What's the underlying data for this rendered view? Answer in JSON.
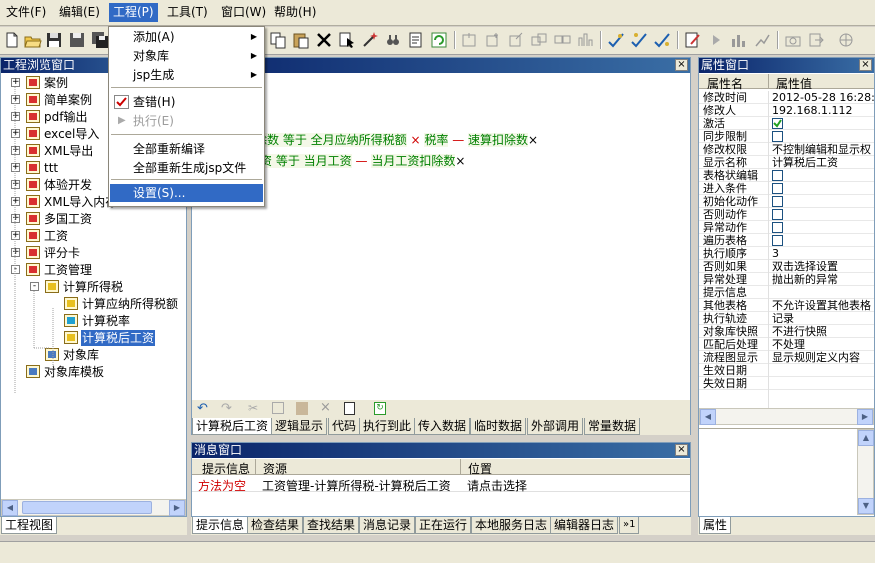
{
  "menubar": {
    "items": [
      "文件(F)",
      "编辑(E)",
      "工程(P)",
      "工具(T)",
      "窗口(W)",
      "帮助(H)"
    ]
  },
  "dropdown": {
    "items": [
      {
        "label": "添加(A)",
        "submenu": true
      },
      {
        "label": "对象库",
        "submenu": true
      },
      {
        "label": "jsp生成",
        "submenu": true
      },
      {
        "label": "查错(H)",
        "checked": true
      },
      {
        "label": "执行(E)",
        "disabled": true
      },
      {
        "label": "全部重新编译"
      },
      {
        "label": "全部重新生成jsp文件"
      },
      {
        "label": "设置(S)...",
        "highlighted": true
      }
    ]
  },
  "project_browser": {
    "title": "工程浏览窗口",
    "tree": [
      {
        "label": "案例",
        "expander": "+",
        "depth": 0
      },
      {
        "label": "简单案例",
        "expander": "+",
        "depth": 0
      },
      {
        "label": "pdf输出",
        "expander": "+",
        "depth": 0
      },
      {
        "label": "excel导入",
        "expander": "+",
        "depth": 0
      },
      {
        "label": "XML导出",
        "expander": "+",
        "depth": 0
      },
      {
        "label": "ttt",
        "expander": "+",
        "depth": 0
      },
      {
        "label": "体验开发",
        "expander": "+",
        "depth": 0
      },
      {
        "label": "XML导入内存",
        "expander": "+",
        "depth": 0
      },
      {
        "label": "多国工资",
        "expander": "+",
        "depth": 0
      },
      {
        "label": "工资",
        "expander": "+",
        "depth": 0
      },
      {
        "label": "评分卡",
        "expander": "+",
        "depth": 0
      },
      {
        "label": "工资管理",
        "expander": "-",
        "depth": 0
      },
      {
        "label": "计算所得税",
        "expander": "-",
        "depth": 1
      },
      {
        "label": "计算应纳所得税额",
        "depth": 2
      },
      {
        "label": "计算税率",
        "depth": 2
      },
      {
        "label": "计算税后工资",
        "depth": 2,
        "selected": true
      },
      {
        "label": "对象库",
        "depth": 1
      },
      {
        "label": "对象库模板",
        "depth": 0
      }
    ],
    "bottom_tab": "工程视图"
  },
  "editor": {
    "rule_lines": [
      [
        {
          "text": "除数",
          "color": "#008000"
        },
        {
          "text": " 等于 ",
          "color": "#008000"
        },
        {
          "text": "全月应纳所得税额",
          "color": "#008000"
        },
        {
          "text": " × ",
          "color": "#d00000"
        },
        {
          "text": "税率",
          "color": "#008000"
        },
        {
          "text": " — ",
          "color": "#d00000"
        },
        {
          "text": "速算扣除数",
          "color": "#008000"
        },
        {
          "text": "×",
          "color": "#000000"
        }
      ],
      [
        {
          "text": "资",
          "color": "#008000"
        },
        {
          "text": " 等于 ",
          "color": "#008000"
        },
        {
          "text": "当月工资",
          "color": "#008000"
        },
        {
          "text": " — ",
          "color": "#d00000"
        },
        {
          "text": "当月工资扣除数",
          "color": "#008000"
        },
        {
          "text": "×",
          "color": "#000000"
        }
      ]
    ],
    "tabs": [
      "计算税后工资",
      "逻辑显示",
      "代码",
      "执行到此",
      "传入数据",
      "临时数据",
      "外部调用",
      "常量数据"
    ],
    "active_tab": 0
  },
  "message_window": {
    "title": "消息窗口",
    "columns": [
      "提示信息",
      "资源",
      "位置"
    ],
    "rows": [
      {
        "hint": "方法为空",
        "resource": "工资管理-计算所得税-计算税后工资",
        "location": "请点击选择"
      }
    ],
    "tabs": [
      "提示信息",
      "检查结果",
      "查找结果",
      "消息记录",
      "正在运行",
      "本地服务日志",
      "编辑器日志"
    ],
    "more_tab": "»1"
  },
  "properties": {
    "title": "属性窗口",
    "col_name": "属性名",
    "col_value": "属性值",
    "rows": [
      {
        "name": "修改时间",
        "value": "2012-05-28 16:28:"
      },
      {
        "name": "修改人",
        "value": "192.168.1.112"
      },
      {
        "name": "激活",
        "checkbox": true,
        "checked": true
      },
      {
        "name": "同步限制",
        "checkbox": true,
        "checked": false
      },
      {
        "name": "修改权限",
        "value": "不控制编辑和显示权"
      },
      {
        "name": "显示名称",
        "value": "计算税后工资"
      },
      {
        "name": "表格状编辑",
        "checkbox": true,
        "checked": false
      },
      {
        "name": "进入条件",
        "checkbox": true,
        "checked": false
      },
      {
        "name": "初始化动作",
        "checkbox": true,
        "checked": false
      },
      {
        "name": "否则动作",
        "checkbox": true,
        "checked": false
      },
      {
        "name": "异常动作",
        "checkbox": true,
        "checked": false
      },
      {
        "name": "遍历表格",
        "checkbox": true,
        "checked": false
      },
      {
        "name": "执行顺序",
        "value": "3"
      },
      {
        "name": "否则如果",
        "value": "双击选择设置"
      },
      {
        "name": "异常处理",
        "value": "抛出新的异常"
      },
      {
        "name": "提示信息",
        "value": ""
      },
      {
        "name": "其他表格",
        "value": "不允许设置其他表格"
      },
      {
        "name": "执行轨迹",
        "value": "记录"
      },
      {
        "name": "对象库快照",
        "value": "不进行快照"
      },
      {
        "name": "匹配后处理",
        "value": "不处理"
      },
      {
        "name": "流程图显示",
        "value": "显示规则定义内容"
      },
      {
        "name": "生效日期",
        "value": ""
      },
      {
        "name": "失效日期",
        "value": ""
      }
    ],
    "bottom_tab": "属性"
  }
}
